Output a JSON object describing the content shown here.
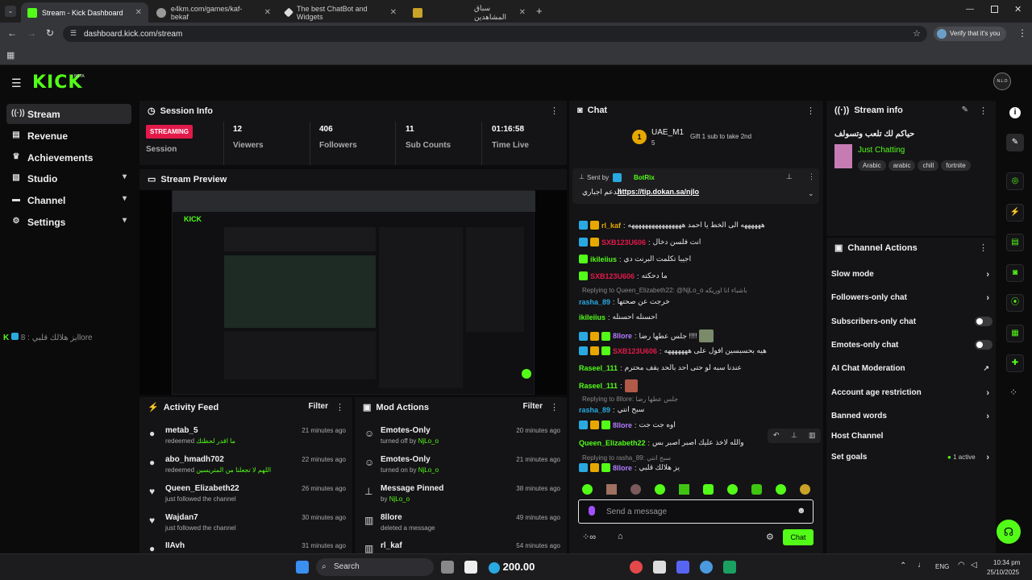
{
  "browser": {
    "tabs": [
      {
        "label": "Stream - Kick Dashboard",
        "active": true
      },
      {
        "label": "e4km.com/games/kaf-bekaf"
      },
      {
        "label": "The best ChatBot and Widgets"
      },
      {
        "label": ""
      },
      {
        "label": "سباق المشاهدين"
      }
    ],
    "url": "dashboard.kick.com/stream",
    "verify_label": "Verify that it's you"
  },
  "header": {
    "logo": "KICK",
    "beta": "BETA",
    "avatar_text": "N.L.O"
  },
  "sidebar": {
    "items": [
      {
        "label": "Stream",
        "icon": "stream-icon"
      },
      {
        "label": "Revenue",
        "icon": "revenue-icon"
      },
      {
        "label": "Achievements",
        "icon": "trophy-icon"
      },
      {
        "label": "Studio",
        "icon": "studio-icon"
      },
      {
        "label": "Channel",
        "icon": "channel-icon"
      },
      {
        "label": "Settings",
        "icon": "gear-icon"
      }
    ]
  },
  "session": {
    "title": "Session Info",
    "status": "STREAMING",
    "status_label": "Session",
    "stats": [
      {
        "value": "12",
        "label": "Viewers"
      },
      {
        "value": "406",
        "label": "Followers"
      },
      {
        "value": "11",
        "label": "Sub Counts"
      },
      {
        "value": "01:16:58",
        "label": "Time Live"
      }
    ]
  },
  "preview": {
    "title": "Stream Preview",
    "overlay_text": "يز هلالك قلبي : 8llore"
  },
  "activity": {
    "title": "Activity Feed",
    "filter": "Filter",
    "items": [
      {
        "name": "metab_5",
        "action": "redeemed",
        "extra": "ما اقدر لحظتك",
        "time": "21 minutes ago"
      },
      {
        "name": "abo_hmadh702",
        "action": "redeemed",
        "extra": "اللهم لا تجعلنا من المتريسين",
        "time": "22 minutes ago"
      },
      {
        "name": "Queen_Elizabeth22",
        "action": "just followed the channel",
        "extra": "",
        "time": "26 minutes ago"
      },
      {
        "name": "Wajdan7",
        "action": "just followed the channel",
        "extra": "",
        "time": "30 minutes ago"
      },
      {
        "name": "IIAvh",
        "action": "",
        "extra": "",
        "time": "31 minutes ago"
      }
    ]
  },
  "mod": {
    "title": "Mod Actions",
    "filter": "Filter",
    "items": [
      {
        "name": "Emotes-Only",
        "action": "turned off by",
        "by": "NjLo_o",
        "time": "20 minutes ago"
      },
      {
        "name": "Emotes-Only",
        "action": "turned on by",
        "by": "NjLo_o",
        "time": "21 minutes ago"
      },
      {
        "name": "Message Pinned",
        "action": "by",
        "by": "NjLo_o",
        "time": "38 minutes ago"
      },
      {
        "name": "8llore",
        "action": "deleted a message",
        "by": "",
        "time": "49 minutes ago"
      },
      {
        "name": "rl_kaf",
        "action": "",
        "by": "",
        "time": "54 minutes ago"
      }
    ]
  },
  "chat": {
    "title": "Chat",
    "gift": {
      "user": "UAE_M1",
      "count": "5",
      "text": "Gift 1 sub to take 2nd"
    },
    "pinned": {
      "sent_by": "Sent by",
      "bot": "BotRix",
      "prefix": "الدعم اجباري",
      "link": "https://tip.dokan.sa/njlo"
    },
    "messages": [
      {
        "user": "rl_kaf",
        "color": "#e6a800",
        "text": "ههههههه الى الخط يا احمد ههههههههههههههههه"
      },
      {
        "user": "SXB123U606",
        "color": "#e3194a",
        "text": "انت فلسن دخال"
      },
      {
        "user": "ikileiius",
        "color": "#53fc18",
        "text": "اجيبا تكلمت البرنت دي"
      },
      {
        "user": "SXB123U606",
        "color": "#e3194a",
        "text": "ما دحكته"
      },
      {
        "reply": "Replying to Queen_Elizabeth22: @NjLo_o باشباء انا اوريكه",
        "user": "rasha_89",
        "color": "#2aa9e0",
        "text": "خرجت عن صحتها"
      },
      {
        "user": "ikileiius",
        "color": "#53fc18",
        "text": "احسنله احسنله"
      },
      {
        "user": "8llore",
        "color": "#b17cff",
        "text": "جلس عطها رضا !!!!"
      },
      {
        "user": "SXB123U606",
        "color": "#e3194a",
        "text": "هيه بحسبسين افول على هههههههه"
      },
      {
        "user": "Raseel_111",
        "color": "#53fc18",
        "text": "عندنا سبه لو حتى احد بالحد يقف محترم"
      },
      {
        "user": "Raseel_111",
        "color": "#53fc18",
        "text": ""
      },
      {
        "reply": "Replying to 8llore: جلس عطها رضا",
        "user": "rasha_89",
        "color": "#2aa9e0",
        "text": "سبح انتي"
      },
      {
        "user": "8llore",
        "color": "#b17cff",
        "text": "اوه جت جت"
      },
      {
        "user": "Queen_Elizabeth22",
        "color": "#53fc18",
        "text": "والله لاخذ عليك اصبر اصبر بس"
      },
      {
        "reply": "Replying to rasha_89: سبح انتي",
        "user": "8llore",
        "color": "#b17cff",
        "text": "يز هلالك قلبي"
      }
    ],
    "input_placeholder": "Send a message",
    "send_label": "Chat"
  },
  "stream_info": {
    "title": "Stream info",
    "stream_title": "حياكم لك تلعب وتسولف",
    "category": "Just Chatting",
    "tags": [
      "Arabic",
      "arabic",
      "chill",
      "fortnite"
    ]
  },
  "channel_actions": {
    "title": "Channel Actions",
    "items": [
      {
        "label": "Slow mode",
        "type": "arrow"
      },
      {
        "label": "Followers-only chat",
        "type": "arrow"
      },
      {
        "label": "Subscribers-only chat",
        "type": "toggle"
      },
      {
        "label": "Emotes-only chat",
        "type": "toggle"
      },
      {
        "label": "AI Chat Moderation",
        "type": "external"
      },
      {
        "label": "Account age restriction",
        "type": "arrow"
      },
      {
        "label": "Banned words",
        "type": "arrow"
      },
      {
        "label": "Host Channel",
        "type": "none"
      },
      {
        "label": "Set goals",
        "type": "arrow",
        "badge": "1 active"
      }
    ]
  },
  "taskbar": {
    "search": "Search",
    "ticker": "200.00",
    "lang": "ENG",
    "time": "10:34 pm",
    "date": "25/10/2025"
  }
}
